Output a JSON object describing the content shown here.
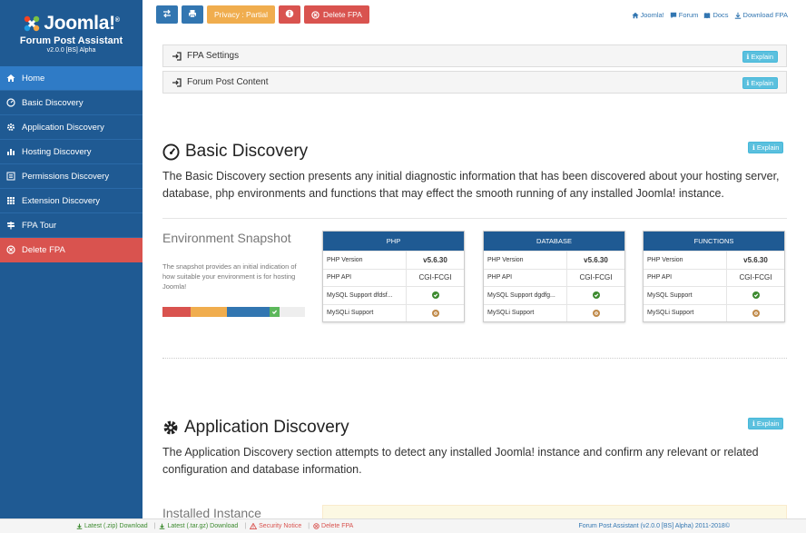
{
  "sidebar": {
    "brand_word": "Joomla!",
    "brand_reg": "®",
    "product": "Forum Post Assistant",
    "version": "v2.0.0 [BS] Alpha",
    "items": [
      {
        "label": "Home",
        "icon": "home-icon"
      },
      {
        "label": "Basic Discovery",
        "icon": "dashboard-icon"
      },
      {
        "label": "Application Discovery",
        "icon": "cog-icon"
      },
      {
        "label": "Hosting Discovery",
        "icon": "chart-icon"
      },
      {
        "label": "Permissions Discovery",
        "icon": "list-icon"
      },
      {
        "label": "Extension Discovery",
        "icon": "grid-icon"
      },
      {
        "label": "FPA Tour",
        "icon": "signpost-icon"
      },
      {
        "label": "Delete FPA",
        "icon": "delete-circle-icon"
      }
    ]
  },
  "toolbar": {
    "privacy_label": "Privacy : Partial",
    "delete_label": "Delete FPA"
  },
  "top_links": {
    "joomla": "Joomla!",
    "forum": "Forum",
    "docs": "Docs",
    "download": "Download FPA"
  },
  "accordions": {
    "settings": "FPA Settings",
    "content": "Forum Post Content",
    "explain": "Explain"
  },
  "basic": {
    "title": "Basic Discovery",
    "explain": "Explain",
    "description": "The Basic Discovery section presents any initial diagnostic information that has been discovered about your hosting server, database, php environments and functions that may effect the smooth running of any installed Joomla! instance."
  },
  "snapshot": {
    "title": "Environment Snapshot",
    "text": "The snapshot provides an initial indication of how suitable your environment is for hosting Joomla!",
    "segments": [
      {
        "color": "#d9534f",
        "fraction": 0.2
      },
      {
        "color": "#f0ad4e",
        "fraction": 0.25
      },
      {
        "color": "#3276b1",
        "fraction": 0.3
      },
      {
        "color": "#5cb85c",
        "fraction": 0.07
      }
    ]
  },
  "tables": [
    {
      "header": "PHP",
      "rows": [
        {
          "label": "PHP Version",
          "value": "v5.6.30",
          "type": "bold"
        },
        {
          "label": "PHP API",
          "value": "CGI-FCGI",
          "type": "text"
        },
        {
          "label": "MySQL Support dfdsf...",
          "value": "",
          "type": "ok"
        },
        {
          "label": "MySQLi Support",
          "value": "",
          "type": "warn"
        }
      ]
    },
    {
      "header": "DATABASE",
      "rows": [
        {
          "label": "PHP Version",
          "value": "v5.6.30",
          "type": "bold"
        },
        {
          "label": "PHP API",
          "value": "CGI-FCGI",
          "type": "text"
        },
        {
          "label": "MySQL Support dgdfg...",
          "value": "",
          "type": "ok"
        },
        {
          "label": "MySQLi Support",
          "value": "",
          "type": "warn"
        }
      ]
    },
    {
      "header": "FUNCTIONS",
      "rows": [
        {
          "label": "PHP Version",
          "value": "v5.6.30",
          "type": "bold"
        },
        {
          "label": "PHP API",
          "value": "CGI-FCGI",
          "type": "text"
        },
        {
          "label": "MySQL Support",
          "value": "",
          "type": "ok"
        },
        {
          "label": "MySQLi Support",
          "value": "",
          "type": "warn"
        }
      ]
    }
  ],
  "application": {
    "title": "Application Discovery",
    "explain": "Explain",
    "description": "The Application Discovery section attempts to detect any installed Joomla! instance and confirm any relevant or related configuration and database information.",
    "installed_title": "Installed Instance"
  },
  "footer": {
    "zip": "Latest (.zip) Download",
    "targz": "Latest (.tar.gz) Download",
    "security": "Security Notice",
    "delete": "Delete FPA",
    "copyright": "Forum Post Assistant (v2.0.0 [BS] Alpha) 2011-2018©"
  },
  "colors": {
    "sidebar": "#1f5a93",
    "active": "#2f7bc6",
    "danger": "#d9534f",
    "warning": "#f0ad4e",
    "info": "#5bc0de",
    "primary": "#3276b1",
    "success": "#3c8a2e"
  }
}
